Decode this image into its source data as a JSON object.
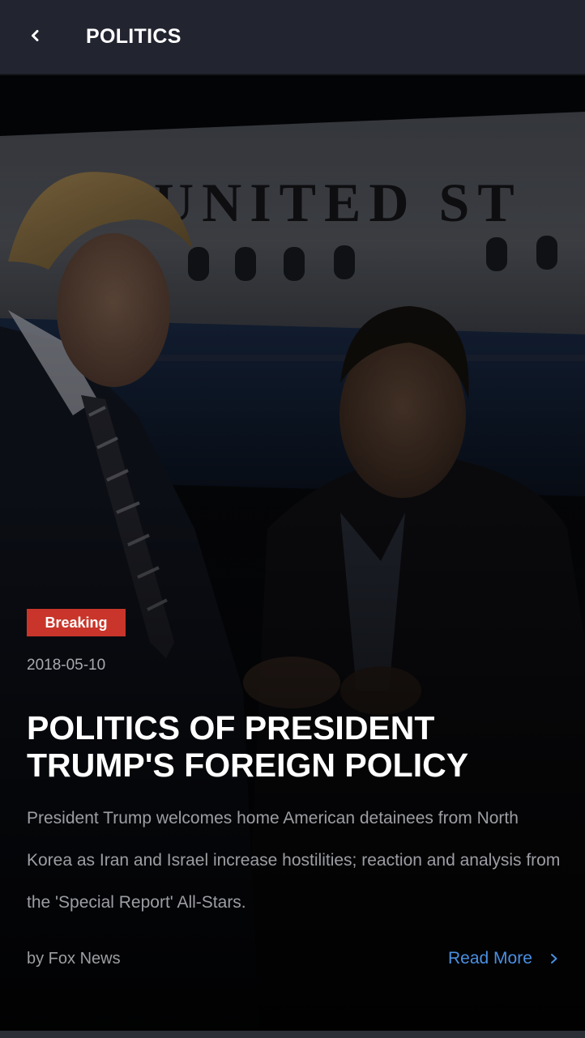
{
  "header": {
    "back_icon": "chevron-left-icon",
    "title": "POLITICS"
  },
  "article": {
    "badge": "Breaking",
    "badge_color": "#c9352a",
    "date": "2018-05-10",
    "title": "POLITICS OF PRESIDENT TRUMP'S FOREIGN POLICY",
    "summary": "President Trump welcomes home American detainees from North Korea as Iran and Israel increase hostilities; reaction and analysis from the 'Special Report' All-Stars.",
    "author": "by Fox News",
    "read_more_label": "Read More",
    "read_more_icon": "chevron-right-icon",
    "image_text": "UNITED ST"
  },
  "colors": {
    "header_bg": "#222430",
    "accent_link": "#4a90e2",
    "background": "#0c0d10"
  }
}
